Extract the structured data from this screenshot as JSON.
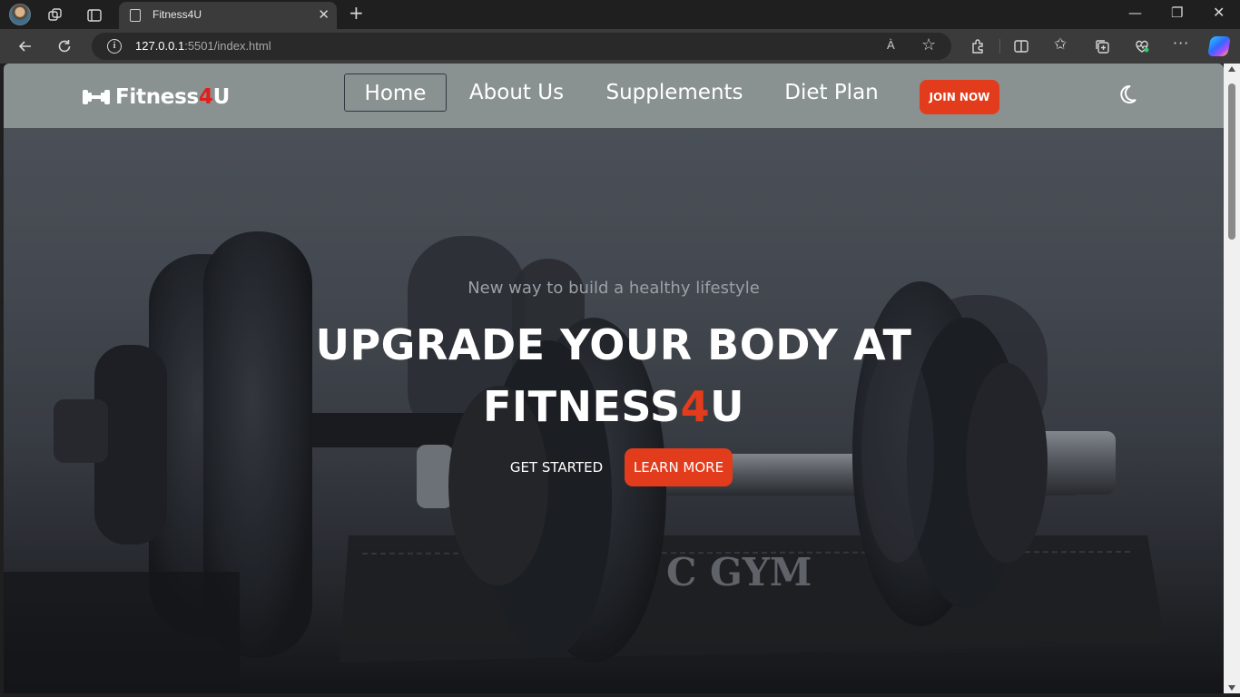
{
  "browser": {
    "tab_title": "Fitness4U",
    "tab_close": "✕",
    "new_tab": "+",
    "url_host": "127.0.0.1",
    "url_rest": ":5501/index.html",
    "read_aloud": "À",
    "window_controls": {
      "minimize": "—",
      "maximize": "❐",
      "close": "✕"
    }
  },
  "navbar": {
    "logo_main": "Fitness",
    "logo_accent": "4",
    "logo_end": "U",
    "links": [
      "Home",
      "About Us",
      "Supplements",
      "Diet Plan"
    ],
    "active_link": "Home",
    "join_label": "JOIN NOW",
    "theme_icon": "moon-icon"
  },
  "hero": {
    "tagline": "New way to build a healthy lifestyle",
    "headline_line1": "UPGRADE YOUR BODY AT",
    "headline_line2_main": "FITNESS",
    "headline_line2_accent": "4",
    "headline_line2_end": "U",
    "get_started": "GET STARTED",
    "learn_more": "LEARN MORE",
    "background_text": "C GYM"
  },
  "colors": {
    "accent": "#e23c1c",
    "logo_accent": "#e01e1e",
    "navbar_bg": "#8c9694",
    "browser_bg": "#1f1f1f"
  }
}
